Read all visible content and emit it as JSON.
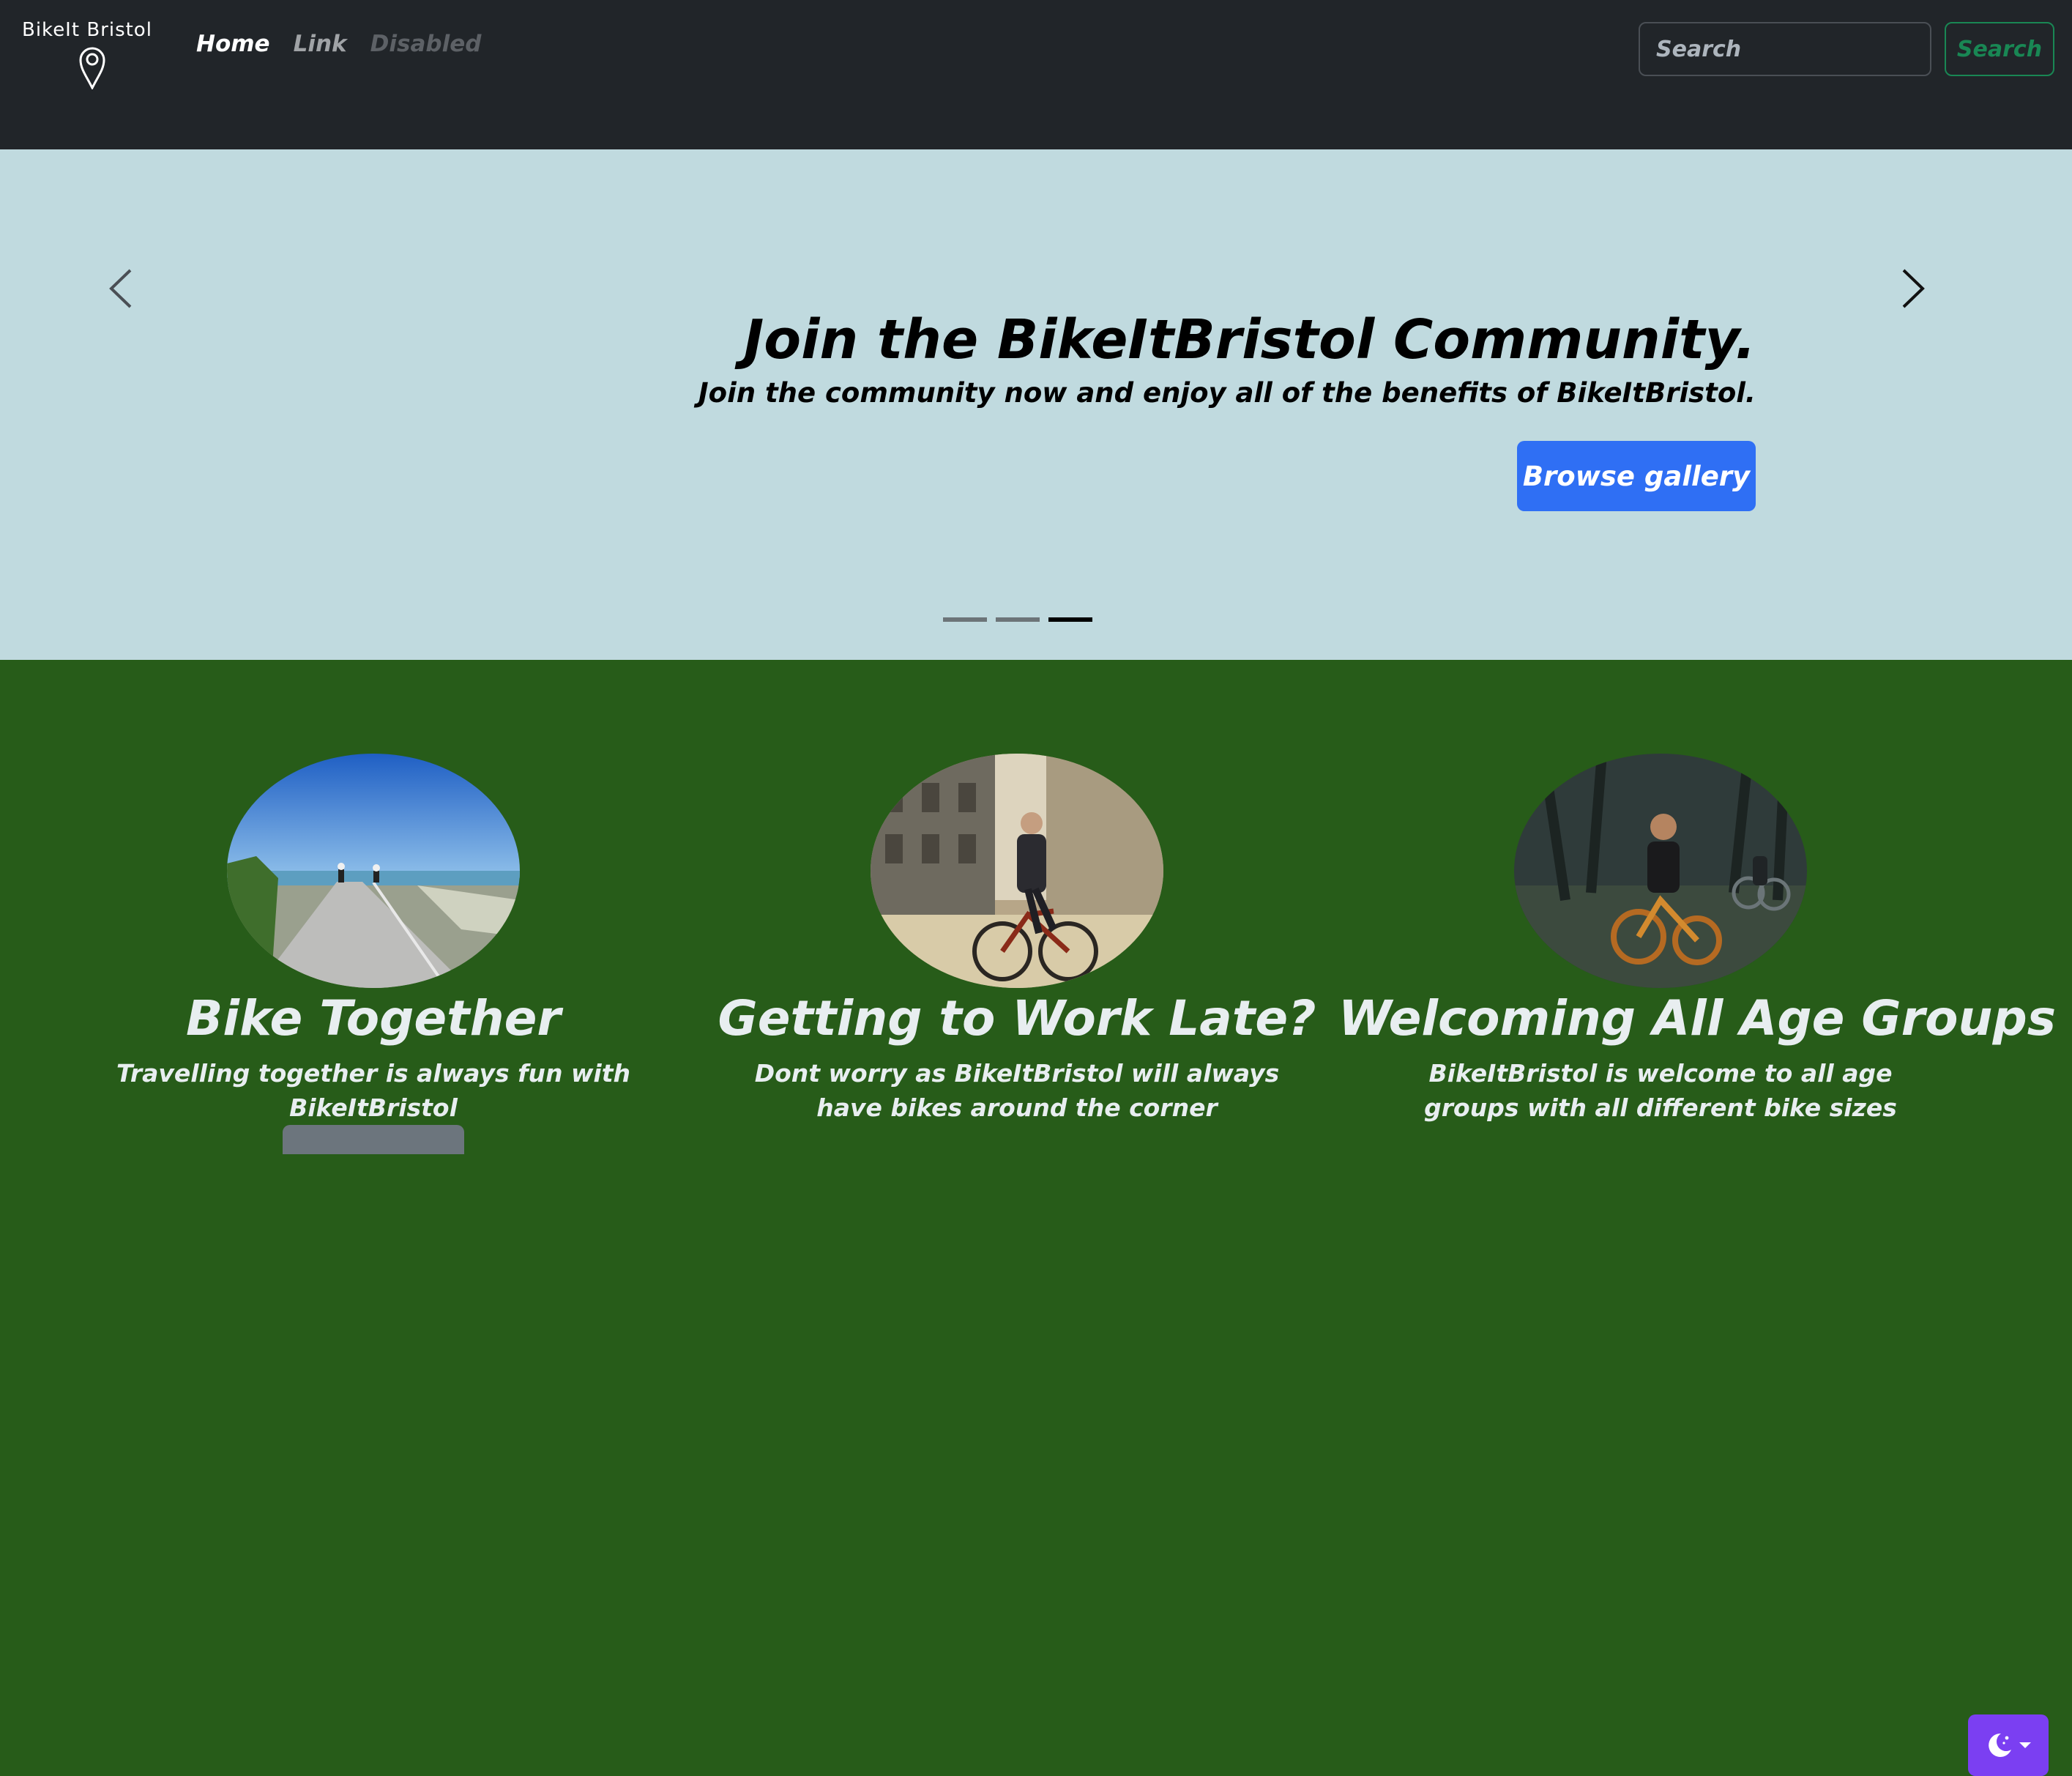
{
  "navbar": {
    "logo_text": "BikeIt Bristol",
    "links": [
      {
        "label": "Home"
      },
      {
        "label": "Link"
      },
      {
        "label": "Disabled"
      }
    ],
    "search": {
      "placeholder": "Search",
      "button_label": "Search"
    }
  },
  "carousel": {
    "heading": "Join the BikeItBristol Community.",
    "text": "Join the community now and enjoy all of the benefits of BikeItBristol.",
    "button_label": "Browse gallery",
    "slide_count": 3,
    "active_slide": 3
  },
  "features": [
    {
      "title": "Bike Together",
      "description": "Travelling together is always fun with BikeItBristol"
    },
    {
      "title": "Getting to Work Late?",
      "description": "Dont worry as BikeItBristol will always have bikes around the corner"
    },
    {
      "title": "Welcoming All Age Groups",
      "description": "BikeItBristol is welcome to all age groups with all different bike sizes"
    }
  ],
  "theme_toggle": {
    "icon": "moon-stars-icon"
  },
  "colors": {
    "navbar": "#212529",
    "carousel_bg": "#c0dadf",
    "features_bg": "#275c19",
    "primary": "#2f6ff4",
    "success": "#198754",
    "toggle": "#7b3ff2"
  }
}
